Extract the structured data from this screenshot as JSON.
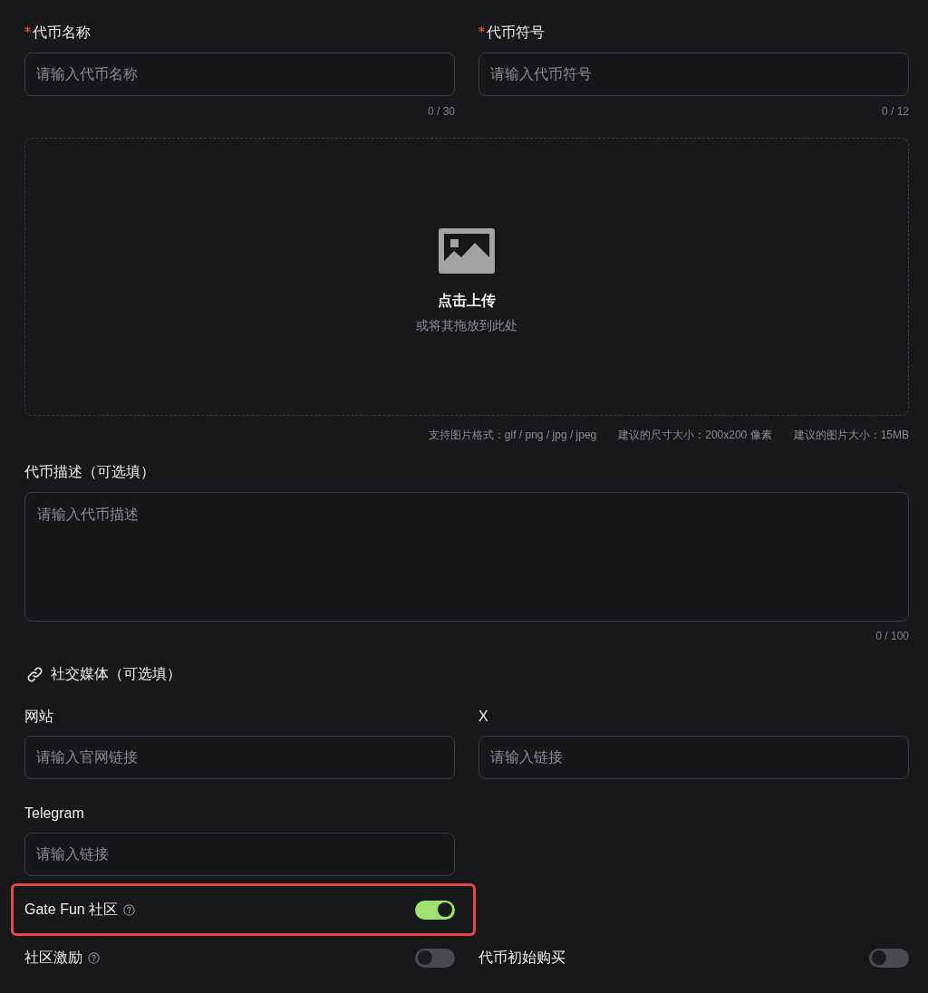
{
  "token_fields": [
    {
      "label": "代币名称",
      "required": true,
      "placeholder": "请输入代币名称",
      "counter": "0 / 30"
    },
    {
      "label": "代币符号",
      "required": true,
      "placeholder": "请输入代币符号",
      "counter": "0 / 12"
    }
  ],
  "upload": {
    "title": "点击上传",
    "subtitle": "或将其拖放到此处",
    "hints": [
      "支持图片格式：gif / png / jpg / jpeg",
      "建议的尺寸大小：200x200 像素",
      "建议的图片大小：15MB"
    ]
  },
  "description": {
    "label": "代币描述（可选填）",
    "placeholder": "请输入代币描述",
    "counter": "0 / 100"
  },
  "social": {
    "heading": "社交媒体（可选填）",
    "fields": [
      {
        "label": "网站",
        "placeholder": "请输入官网链接"
      },
      {
        "label": "X",
        "placeholder": "请输入链接"
      },
      {
        "label": "Telegram",
        "placeholder": "请输入链接"
      }
    ]
  },
  "toggle_rows": [
    [
      {
        "label": "Gate Fun 社区",
        "help": true,
        "on": true,
        "highlighted": true
      }
    ],
    [
      {
        "label": "社区激励",
        "help": true,
        "on": false,
        "highlighted": false
      },
      {
        "label": "代币初始购买",
        "help": false,
        "on": false,
        "highlighted": false
      }
    ]
  ]
}
